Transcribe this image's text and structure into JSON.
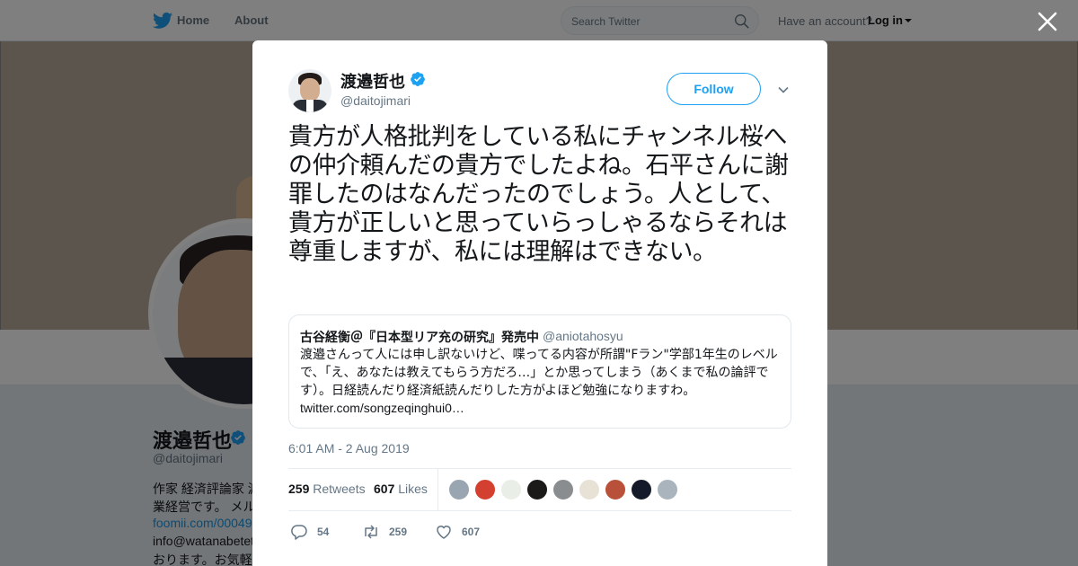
{
  "nav": {
    "home": "Home",
    "about": "About",
    "search_placeholder": "Search Twitter",
    "have_account": "Have an account?",
    "login": "Log in"
  },
  "profile": {
    "name": "渡邉哲也",
    "handle": "@daitojimari",
    "bio_line1": "作家 経済評論家 渡",
    "bio_line2": "業経営です。 メル",
    "link": "foomii.com/00049",
    "email": "info@watanabetet",
    "bio_line3": "おります。お気軽"
  },
  "tweet": {
    "author_name": "渡邉哲也",
    "author_handle": "@daitojimari",
    "follow_label": "Follow",
    "text": "貴方が人格批判をしている私にチャンネル桜への仲介頼んだの貴方でしたよね。石平さんに謝罪したのはなんだったのでしょう。人として、貴方が正しいと思っていらっしゃるならそれは尊重しますが、私には理解はできない。",
    "quote": {
      "name": "古谷経衡＠『日本型リア充の研究』発売中",
      "handle": "@aniotahosyu",
      "text": "渡邉さんって人には申し訳ないけど、喋ってる内容が所謂\"Fラン\"学部1年生のレベルで、「え、あなたは教えてもらう方だろ…」とか思ってしまう（あくまで私の論評です）。日経読んだり経済紙読んだりした方がよほど勉強になりますわ。",
      "link": "twitter.com/songzeqinghui0…"
    },
    "timestamp": "6:01 AM - 2 Aug 2019",
    "retweets_count": "259",
    "retweets_label": "Retweets",
    "likes_count": "607",
    "likes_label": "Likes",
    "likers": [
      "default-avatar",
      "red-helmet-avatar",
      "green-figure-avatar",
      "black-cat-avatar",
      "gray-photo-avatar",
      "drawing-avatar",
      "red-photo-avatar",
      "dark-blue-avatar",
      "default-avatar"
    ],
    "actions": {
      "reply_count": "54",
      "retweet_count": "259",
      "like_count": "607"
    }
  },
  "colors": {
    "accent": "#1da1f2",
    "link": "#1b95e0",
    "muted": "#657786"
  }
}
